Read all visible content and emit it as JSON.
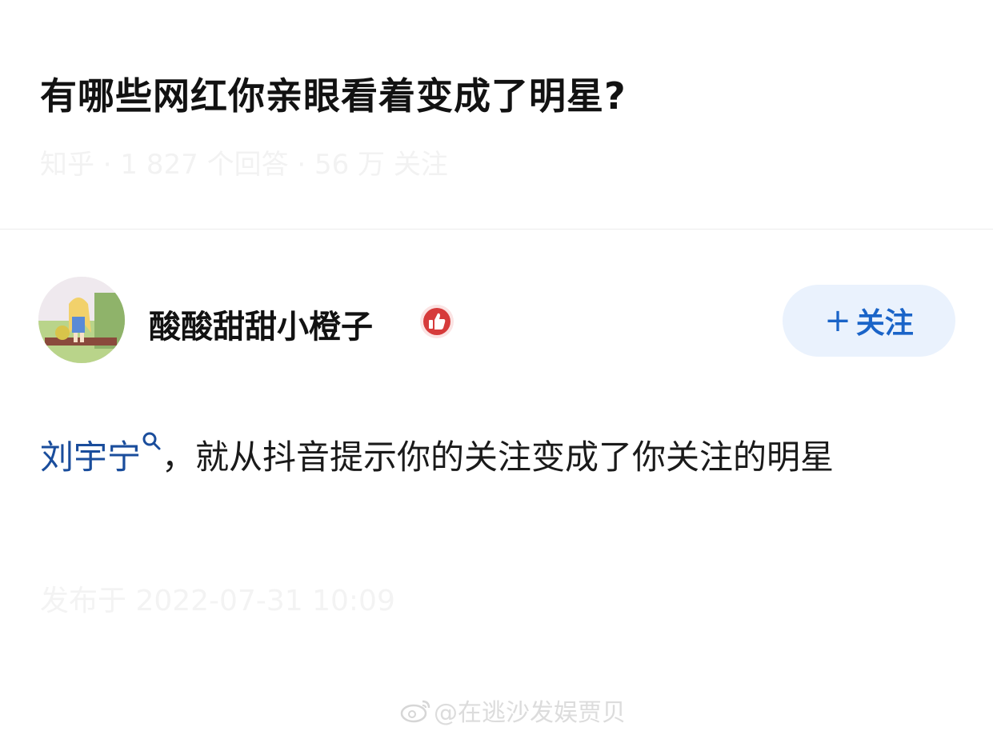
{
  "question": {
    "title": "有哪些网红你亲眼看着变成了明星?",
    "meta": "知乎 · 1 827 个回答 · 56 万 关注"
  },
  "author": {
    "name": "酸酸甜甜小橙子",
    "avatar_icon": "avatar-anime-girl",
    "badge_icon": "thumbs-up-badge-icon",
    "follow_label": "关注",
    "follow_plus": "+"
  },
  "answer": {
    "mention": "刘宇宁",
    "text_line": "，就从抖音提示你的关注变成了你关注的明星",
    "time": "发布于 2022-07-31 10:09"
  },
  "watermark": {
    "text": "@在逃沙发娱贾贝"
  },
  "colors": {
    "accent": "#1a64c8",
    "mention": "#1a4d9c",
    "follow_bg": "#eaf2fd",
    "badge": "#d63b3b"
  }
}
